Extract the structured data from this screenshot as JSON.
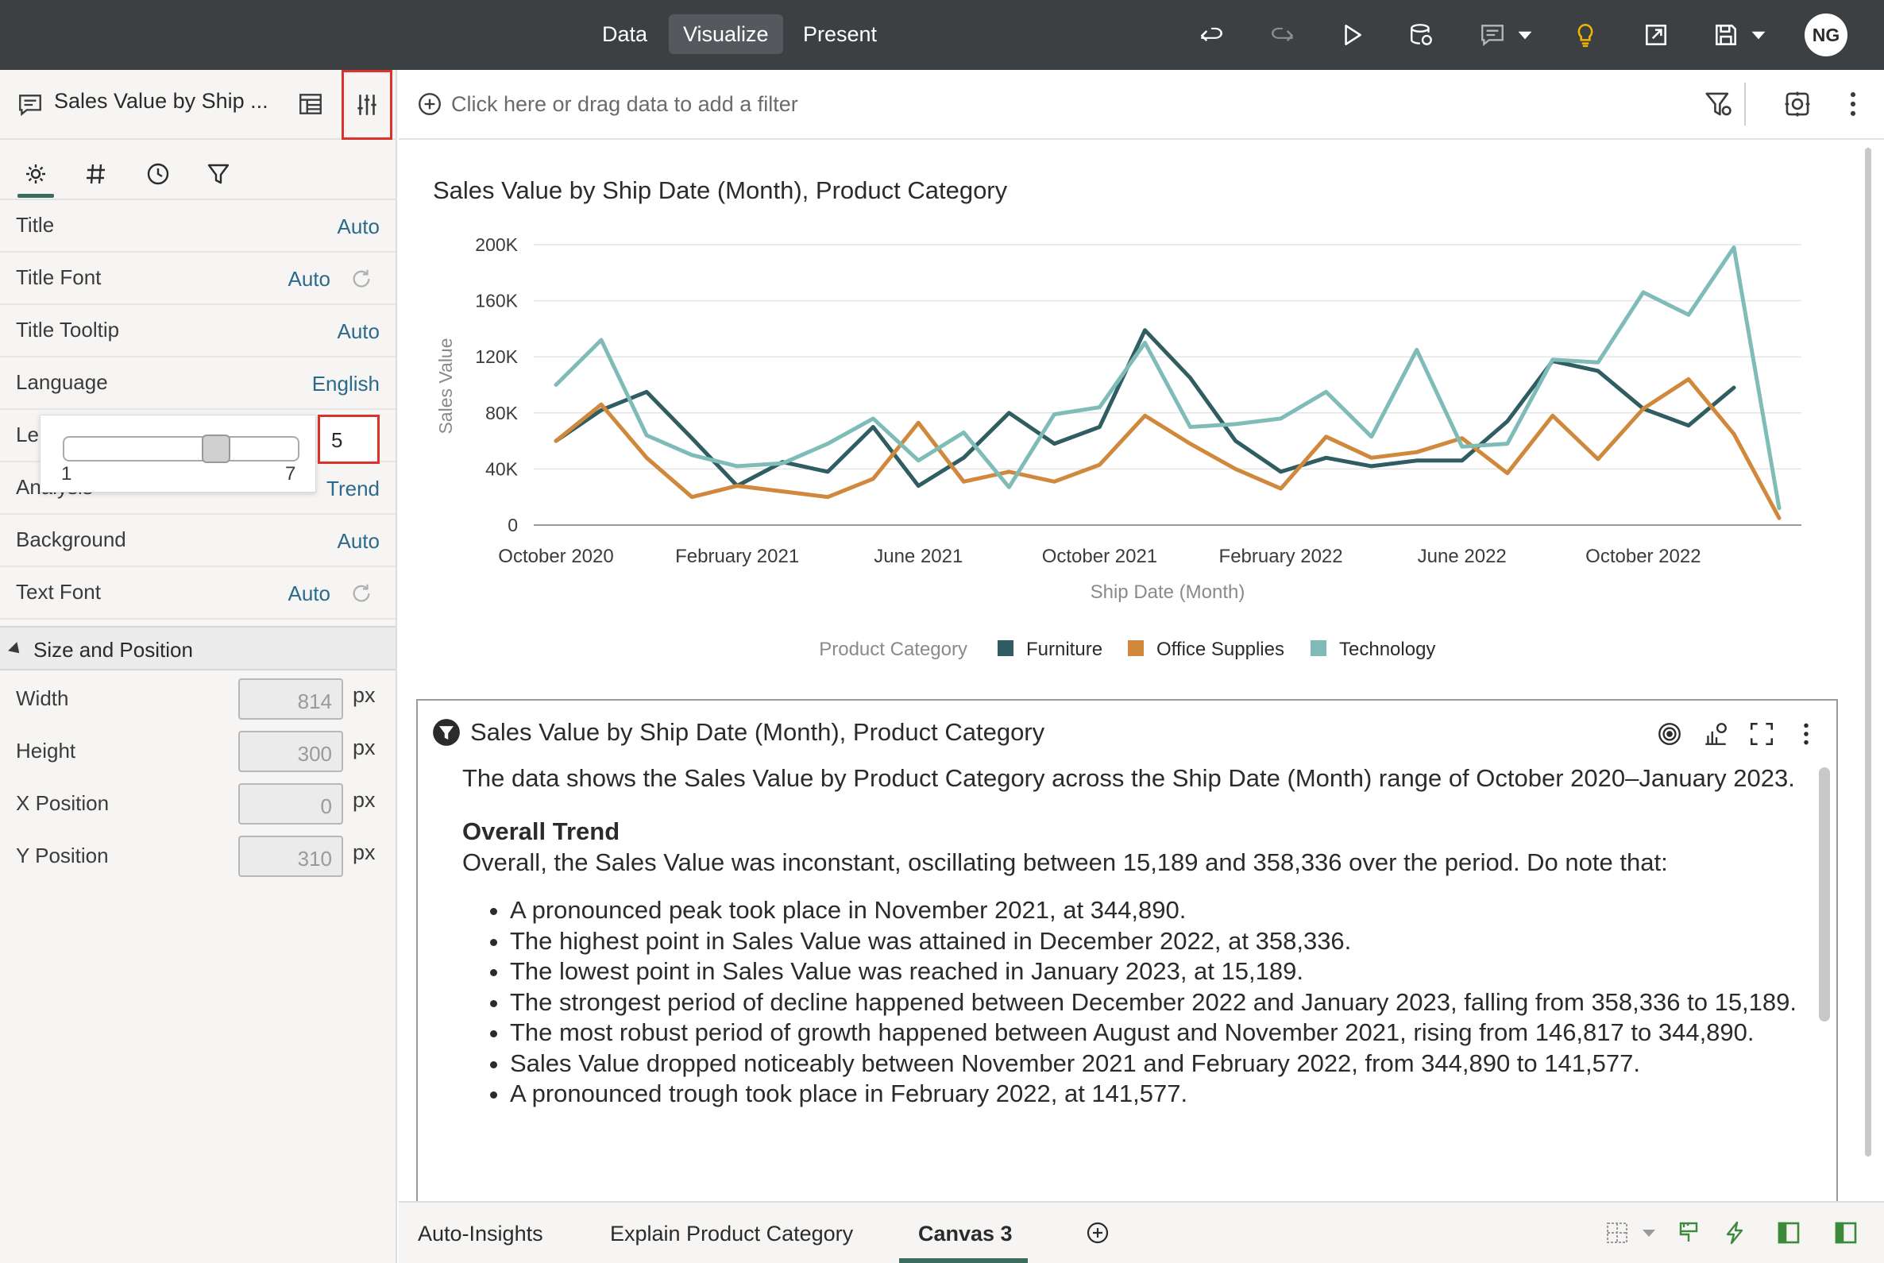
{
  "topbar": {
    "tabs": [
      {
        "label": "Data",
        "active": false
      },
      {
        "label": "Visualize",
        "active": true
      },
      {
        "label": "Present",
        "active": false
      }
    ],
    "icons": [
      "undo-icon",
      "redo-icon",
      "play-icon",
      "refresh-data-icon",
      "comment-icon",
      "lightbulb-icon",
      "export-icon",
      "save-icon"
    ],
    "user_initials": "NG",
    "bg_color": "#3c4043",
    "lightbulb_color": "#f0b400"
  },
  "left_panel": {
    "viz_title": "Sales Value by Ship ...",
    "properties": [
      {
        "label": "Title",
        "value": "Auto"
      },
      {
        "label": "Title Font",
        "value": "Auto"
      },
      {
        "label": "Title Tooltip",
        "value": "Auto"
      },
      {
        "label": "Language",
        "value": "English"
      },
      {
        "label": "Le",
        "value": ""
      },
      {
        "label": "Analysis",
        "value": "Trend"
      },
      {
        "label": "Background",
        "value": "Auto"
      },
      {
        "label": "Text Font",
        "value": "Auto"
      }
    ],
    "slider": {
      "min": "1",
      "max": "7",
      "value": "5",
      "level_fraction": 0.667
    },
    "section": "Size and Position",
    "size": [
      {
        "label": "Width",
        "value": "814",
        "unit": "px"
      },
      {
        "label": "Height",
        "value": "300",
        "unit": "px"
      },
      {
        "label": "X Position",
        "value": "0",
        "unit": "px"
      },
      {
        "label": "Y Position",
        "value": "310",
        "unit": "px"
      }
    ]
  },
  "filter_bar": {
    "placeholder": "Click here or drag data to add a filter"
  },
  "chart_data": {
    "type": "line",
    "title": "Sales Value by Ship Date (Month), Product Category",
    "xlabel": "Ship Date (Month)",
    "ylabel": "Sales Value",
    "ylim": [
      0,
      200000
    ],
    "yticks": [
      "0",
      "40K",
      "80K",
      "120K",
      "160K",
      "200K"
    ],
    "xticks": [
      "October 2020",
      "February 2021",
      "June 2021",
      "October 2021",
      "February 2022",
      "June 2022",
      "October 2022"
    ],
    "legend_title": "Product Category",
    "legend_position": "bottom-center",
    "grid": true,
    "x": [
      "2020-10",
      "2020-11",
      "2020-12",
      "2021-01",
      "2021-02",
      "2021-03",
      "2021-04",
      "2021-05",
      "2021-06",
      "2021-07",
      "2021-08",
      "2021-09",
      "2021-10",
      "2021-11",
      "2021-12",
      "2022-01",
      "2022-02",
      "2022-03",
      "2022-04",
      "2022-05",
      "2022-06",
      "2022-07",
      "2022-08",
      "2022-09",
      "2022-10",
      "2022-11",
      "2022-12",
      "2023-01"
    ],
    "series": [
      {
        "name": "Furniture",
        "color": "#2f5d62",
        "values": [
          60000,
          82000,
          95000,
          62000,
          28000,
          45000,
          38000,
          70000,
          28000,
          48000,
          80000,
          58000,
          70000,
          139000,
          105000,
          60000,
          38000,
          48000,
          42000,
          46000,
          46000,
          74000,
          117000,
          110000,
          83000,
          71000,
          98000,
          null
        ]
      },
      {
        "name": "Office Supplies",
        "color": "#d0893c",
        "values": [
          60000,
          86000,
          48000,
          20000,
          28000,
          24000,
          20000,
          33000,
          73000,
          31000,
          38000,
          31000,
          43000,
          78000,
          58000,
          40000,
          26000,
          63000,
          48000,
          52000,
          62000,
          37000,
          78000,
          47000,
          83000,
          104000,
          65000,
          5000
        ]
      },
      {
        "name": "Technology",
        "color": "#7fbcb8",
        "values": [
          100000,
          132000,
          64000,
          50000,
          42000,
          44000,
          58000,
          76000,
          46000,
          66000,
          27000,
          79000,
          84000,
          130000,
          70000,
          72000,
          76000,
          95000,
          63000,
          125000,
          56000,
          58000,
          118000,
          116000,
          166000,
          150000,
          198000,
          12000
        ]
      }
    ]
  },
  "insights": {
    "title": "Sales Value by Ship Date (Month), Product Category",
    "intro": "The data shows the Sales Value by Product Category across the Ship Date (Month) range of October 2020–January 2023.",
    "heading": "Overall Trend",
    "summary": "Overall, the Sales Value was inconstant, oscillating between 15,189 and 358,336 over the period. Do note that:",
    "bullets": [
      "A pronounced peak took place in November 2021, at 344,890.",
      "The highest point in Sales Value was attained in December 2022, at 358,336.",
      "The lowest point in Sales Value was reached in January 2023, at 15,189.",
      "The strongest period of decline happened between December 2022 and January 2023, falling from 358,336 to 15,189.",
      "The most robust period of growth happened between August and November 2021, rising from 146,817 to 344,890.",
      "Sales Value dropped noticeably between November 2021 and February 2022, from 344,890 to 141,577.",
      "A pronounced trough took place in February 2022, at 141,577."
    ]
  },
  "bottom_tabs": [
    {
      "label": "Auto-Insights",
      "active": false
    },
    {
      "label": "Explain Product Category",
      "active": false
    },
    {
      "label": "Canvas 3",
      "active": true
    }
  ],
  "accent_color": "#3d6b5e",
  "highlight_color": "#d9332b"
}
